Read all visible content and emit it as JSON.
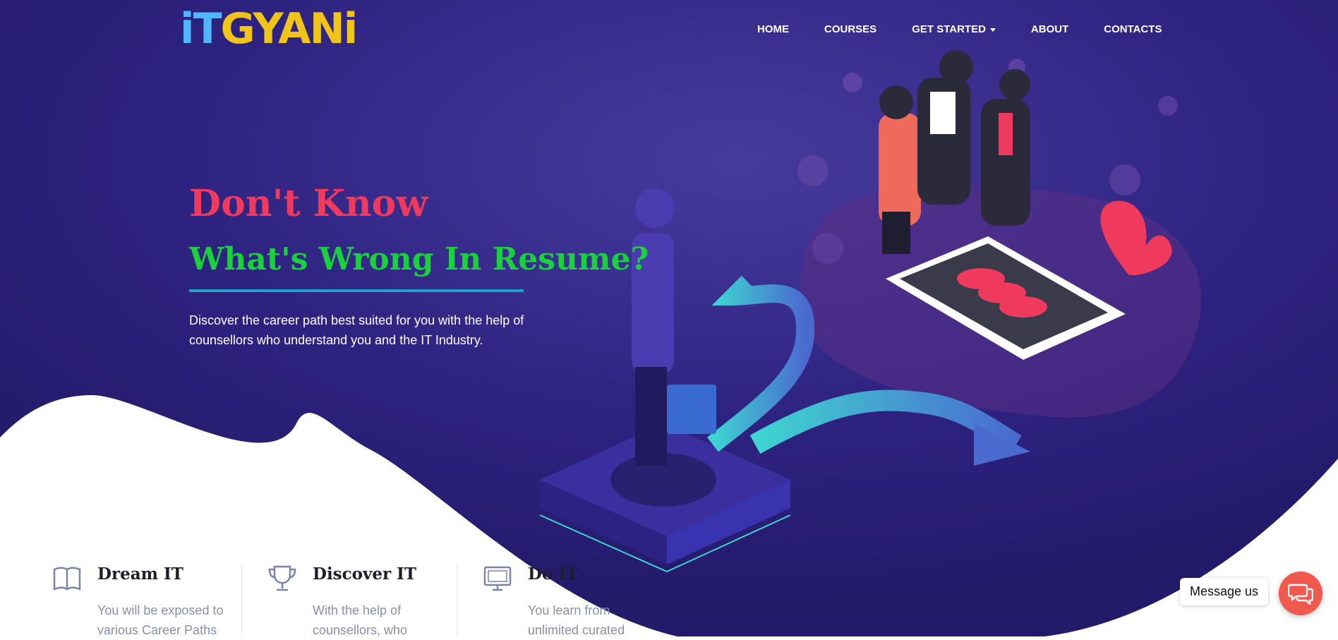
{
  "brand": {
    "logo_it": "iT",
    "logo_gyani": "GYANi",
    "colors": {
      "it": "#4fb6ff",
      "gyani": "#f0c419"
    }
  },
  "nav": {
    "items": [
      {
        "label": "HOME"
      },
      {
        "label": "COURSES"
      },
      {
        "label": "GET STARTED",
        "has_dropdown": true
      },
      {
        "label": "ABOUT"
      },
      {
        "label": "CONTACTS"
      }
    ]
  },
  "hero": {
    "headline_line1": "Don't Know",
    "headline_line2": "What's Wrong In Resume?",
    "description": "Discover the career path best suited for you with the help of counsellors who understand you and the IT Industry.",
    "colors": {
      "background": "#2b1f7a",
      "headline1": "#ef3a5d",
      "headline2": "#19d13a",
      "underline": "#1ba3c9"
    }
  },
  "features": [
    {
      "icon": "book-icon",
      "title": "Dream IT",
      "text": "You will be exposed to various Career Paths"
    },
    {
      "icon": "trophy-icon",
      "title": "Discover IT",
      "text": "With the help of counsellors, who"
    },
    {
      "icon": "monitor-icon",
      "title": "Do IT",
      "text": "You learn from unlimited curated"
    }
  ],
  "chat_widget": {
    "label": "Message us",
    "icon": "chat-bubbles-icon",
    "color": "#f05a4e"
  }
}
